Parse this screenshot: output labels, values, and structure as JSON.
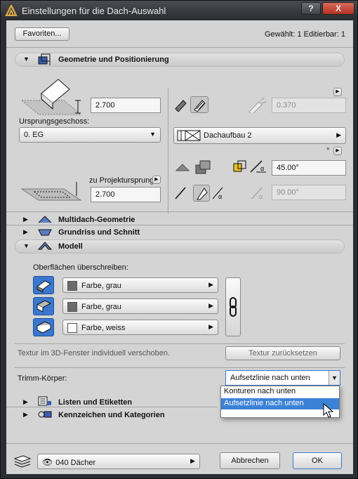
{
  "window": {
    "title": "Einstellungen für die Dach-Auswahl",
    "help_label": "?",
    "close_label": "X"
  },
  "top": {
    "favorites_label": "Favoriten...",
    "selection_info": "Gewählt: 1 Editierbar: 1"
  },
  "geometry": {
    "header": "Geometrie und Positionierung",
    "height_value": "2.700",
    "origin_floor_label": "Ursprungsgeschoss:",
    "origin_floor_value": "0. EG",
    "project_origin_label": "zu Projektursprung",
    "project_origin_value": "2.700",
    "thickness_value": "0.370",
    "structure_value": "Dachaufbau 2",
    "angle_value": "45.00°",
    "angle2_value": "90.00°",
    "degree_symbol": "°",
    "arrow_glyph": "▶"
  },
  "sections": {
    "multiroof": "Multidach-Geometrie",
    "floorplan": "Grundriss und Schnitt",
    "model": "Modell",
    "lists": "Listen und Etiketten",
    "tags": "Kennzeichen und Kategorien"
  },
  "model": {
    "override_label": "Oberflächen überschreiben:",
    "surfaces": [
      {
        "label": "Farbe, grau",
        "color": "#6b6b6b"
      },
      {
        "label": "Farbe, grau",
        "color": "#6b6b6b"
      },
      {
        "label": "Farbe, weiss",
        "color": "#ffffff"
      }
    ],
    "texture_note": "Textur im 3D-Fenster individuell verschoben.",
    "texture_reset_label": "Textur zurücksetzen",
    "trim_label": "Trimm-Körper:",
    "trim_value": "Aufsetzlinie nach unten",
    "trim_options": [
      "Konturen nach unten",
      "Aufsetzlinie nach unten"
    ]
  },
  "bottom": {
    "layer_value": "040 Dächer",
    "cancel_label": "Abbrechen",
    "ok_label": "OK"
  },
  "colors": {
    "accent": "#3a78d0",
    "selected": "#3b82d6"
  }
}
